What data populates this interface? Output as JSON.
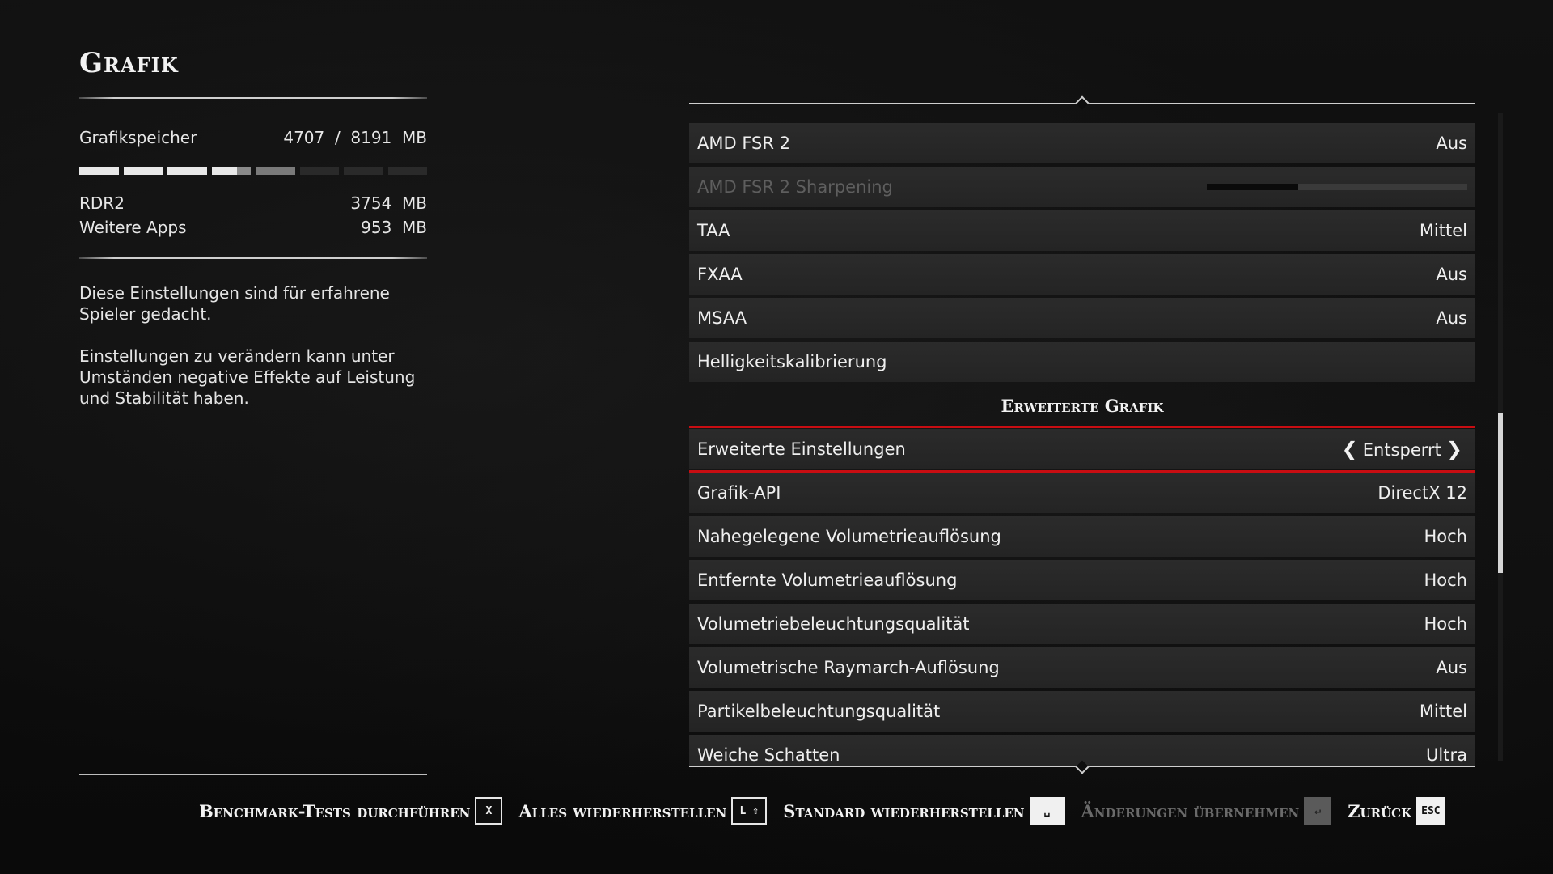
{
  "left": {
    "title": "Grafik",
    "memory_label": "Grafikspeicher",
    "memory_value": "4707  /  8191  MB",
    "memory_used_fraction": 0.575,
    "rdr2_label": "RDR2",
    "rdr2_value": "3754  MB",
    "other_label": "Weitere Apps",
    "other_value": "953  MB",
    "desc1": "Diese Einstellungen sind für erfahrene Spieler gedacht.",
    "desc2": "Einstellungen zu verändern kann unter Umständen negative Effekte auf Leistung und Stabilität haben."
  },
  "settings": {
    "rows": [
      {
        "label": "AMD FSR 2",
        "value": "Aus"
      },
      {
        "label": "AMD FSR 2 Sharpening",
        "value": "",
        "dim": true,
        "slider": 0.35
      },
      {
        "label": "TAA",
        "value": "Mittel"
      },
      {
        "label": "FXAA",
        "value": "Aus"
      },
      {
        "label": "MSAA",
        "value": "Aus"
      },
      {
        "label": "Helligkeitskalibrierung",
        "value": ""
      }
    ],
    "section_title": "Erweiterte Grafik",
    "advanced_rows": [
      {
        "label": "Erweiterte Einstellungen",
        "value": "Entsperrt",
        "selected": true
      },
      {
        "label": "Grafik-API",
        "value": "DirectX 12"
      },
      {
        "label": "Nahegelegene Volumetrieauflösung",
        "value": "Hoch"
      },
      {
        "label": "Entfernte Volumetrieauflösung",
        "value": "Hoch"
      },
      {
        "label": "Volumetriebeleuchtungsqualität",
        "value": "Hoch"
      },
      {
        "label": "Volumetrische Raymarch-Auflösung",
        "value": "Aus"
      },
      {
        "label": "Partikelbeleuchtungsqualität",
        "value": "Mittel"
      },
      {
        "label": "Weiche Schatten",
        "value": "Ultra"
      }
    ]
  },
  "footer": {
    "benchmark": "Benchmark-Tests durchführen",
    "benchmark_key": "X",
    "restore_all": "Alles wiederherstellen",
    "restore_all_key": "L ⇧",
    "restore_default": "Standard wiederherstellen",
    "restore_default_key": "␣",
    "apply": "Änderungen übernehmen",
    "apply_key": "↵",
    "back": "Zurück",
    "back_key": "ESC"
  },
  "colors": {
    "selection": "#c80d12",
    "row": "#272727",
    "background": "#0d0d0d"
  }
}
